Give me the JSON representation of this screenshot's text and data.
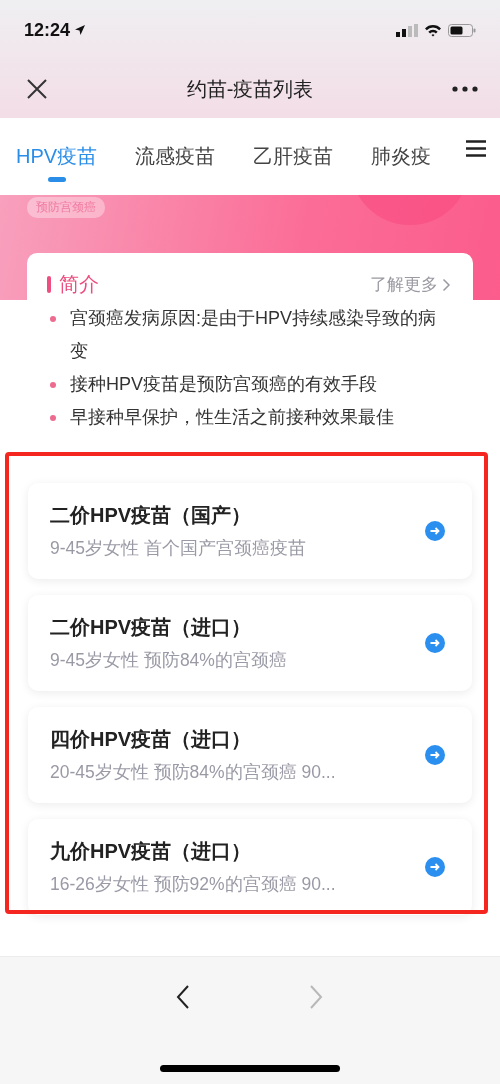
{
  "status_bar": {
    "time": "12:24"
  },
  "header": {
    "title": "约苗-疫苗列表"
  },
  "tabs": [
    {
      "label": "HPV疫苗",
      "selected": true
    },
    {
      "label": "流感疫苗",
      "selected": false
    },
    {
      "label": "乙肝疫苗",
      "selected": false
    },
    {
      "label": "肺炎疫",
      "selected": false
    }
  ],
  "banner": {
    "tag": "预防宫颈癌"
  },
  "intro": {
    "title": "简介",
    "more_link": "了解更多",
    "bullets": [
      "宫颈癌发病原因:是由于HPV持续感染导致的病变",
      "接种HPV疫苗是预防宫颈癌的有效手段",
      "早接种早保护，性生活之前接种效果最佳"
    ]
  },
  "vaccines": [
    {
      "name": "二价HPV疫苗（国产）",
      "description": "9-45岁女性 首个国产宫颈癌疫苗"
    },
    {
      "name": "二价HPV疫苗（进口）",
      "description": "9-45岁女性 预防84%的宫颈癌"
    },
    {
      "name": "四价HPV疫苗（进口）",
      "description": "20-45岁女性 预防84%的宫颈癌 90..."
    },
    {
      "name": "九价HPV疫苗（进口）",
      "description": "16-26岁女性 预防92%的宫颈癌 90..."
    }
  ],
  "bottom_nav": {
    "back": {
      "disabled": false
    },
    "forward": {
      "disabled": true
    }
  }
}
